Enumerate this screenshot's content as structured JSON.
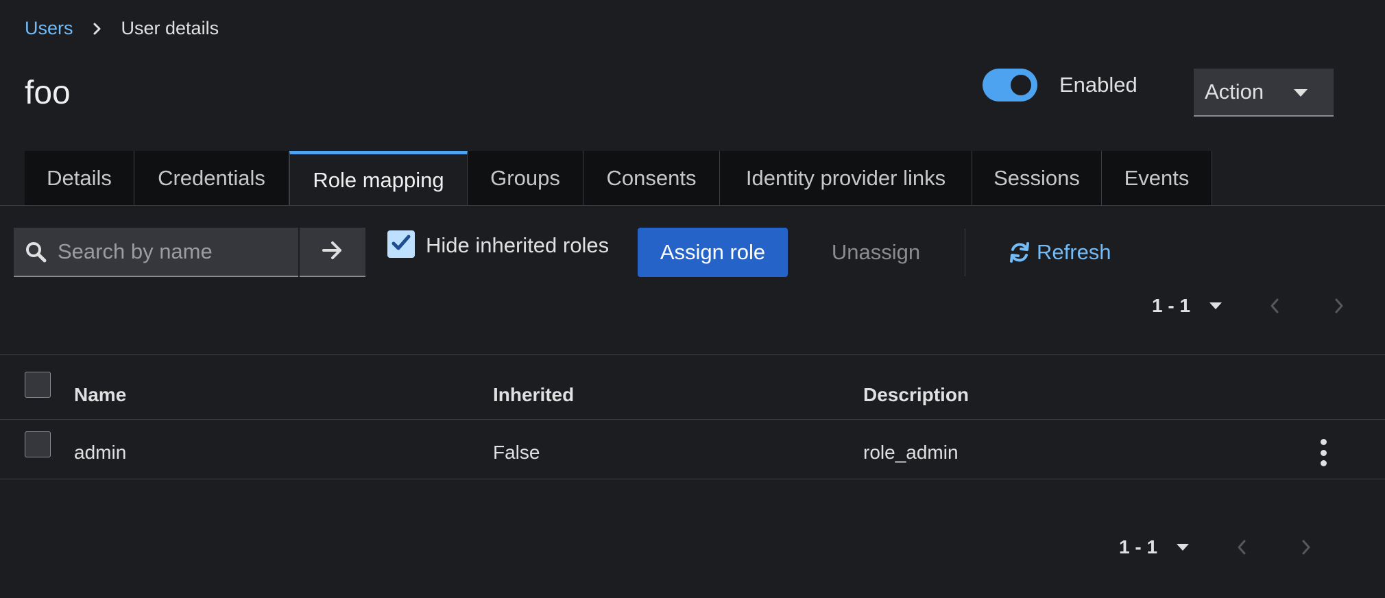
{
  "breadcrumb": {
    "parent": "Users",
    "current": "User details"
  },
  "title": "foo",
  "enabled_label": "Enabled",
  "enabled_state": true,
  "action_label": "Action",
  "tabs": [
    {
      "label": "Details"
    },
    {
      "label": "Credentials"
    },
    {
      "label": "Role mapping"
    },
    {
      "label": "Groups"
    },
    {
      "label": "Consents"
    },
    {
      "label": "Identity provider links"
    },
    {
      "label": "Sessions"
    },
    {
      "label": "Events"
    }
  ],
  "active_tab": "Role mapping",
  "toolbar": {
    "search_placeholder": "Search by name",
    "hide_inherited_label": "Hide inherited roles",
    "hide_inherited_checked": true,
    "assign_label": "Assign role",
    "unassign_label": "Unassign",
    "refresh_label": "Refresh"
  },
  "pagination": {
    "range": "1 - 1"
  },
  "table": {
    "columns": [
      "Name",
      "Inherited",
      "Description"
    ],
    "rows": [
      {
        "name": "admin",
        "inherited": "False",
        "description": "role_admin"
      }
    ]
  },
  "colors": {
    "accent": "#4da3f0",
    "link": "#73bcf7",
    "primary_button": "#2563c9",
    "background": "#1b1d21"
  },
  "icons": [
    "chevron-right-icon",
    "search-icon",
    "arrow-right-icon",
    "check-icon",
    "sync-icon",
    "caret-down-icon",
    "angle-left-icon",
    "angle-right-icon",
    "kebab-icon"
  ]
}
